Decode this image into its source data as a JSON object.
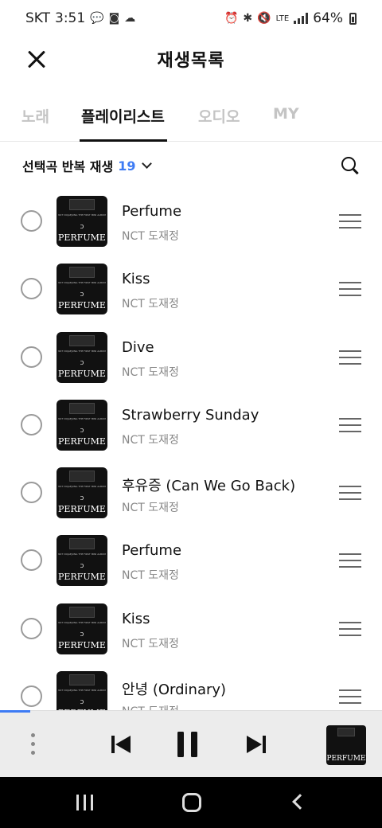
{
  "status_bar": {
    "carrier": "SKT",
    "time": "3:51",
    "network": "LTE",
    "battery": "64%"
  },
  "header": {
    "title": "재생목록"
  },
  "tabs": [
    {
      "label": "노래",
      "active": false
    },
    {
      "label": "플레이리스트",
      "active": true
    },
    {
      "label": "오디오",
      "active": false
    },
    {
      "label": "MY",
      "active": false
    }
  ],
  "list_header": {
    "mode_label": "선택곡 반복 재생",
    "count": "19"
  },
  "album_art": {
    "text": "PERFUME",
    "small_text": "NCT DOJAEJUNG THE FIRST MINI ALBUM"
  },
  "tracks": [
    {
      "title": "Perfume",
      "artist": "NCT 도재정"
    },
    {
      "title": "Kiss",
      "artist": "NCT 도재정"
    },
    {
      "title": "Dive",
      "artist": "NCT 도재정"
    },
    {
      "title": "Strawberry Sunday",
      "artist": "NCT 도재정"
    },
    {
      "title": "후유증 (Can We Go Back)",
      "artist": "NCT 도재정"
    },
    {
      "title": "Perfume",
      "artist": "NCT 도재정"
    },
    {
      "title": "Kiss",
      "artist": "NCT 도재정"
    },
    {
      "title": "안녕 (Ordinary)",
      "artist": "NCT 도재정"
    }
  ],
  "player": {
    "progress": 0.08,
    "accent_color": "#3d7bf4"
  }
}
